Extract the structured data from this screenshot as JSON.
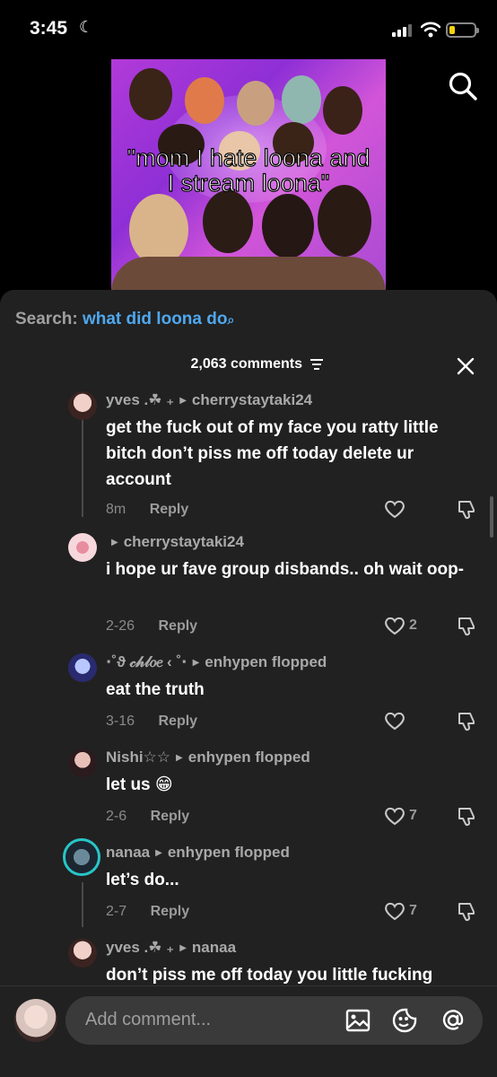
{
  "status": {
    "time": "3:45"
  },
  "video": {
    "caption_line1": "\"mom I hate loona and",
    "caption_line2": "I stream loona\""
  },
  "search": {
    "label": "Search:",
    "query": "what did loona do"
  },
  "header": {
    "count": "2,063 comments"
  },
  "comments": [
    {
      "user": "yves .☘︎ ₊",
      "reply_to": "cherrystaytaki24",
      "text": "get the fuck out of my face you ratty little bitch don’t piss me off today delete ur account",
      "time": "8m",
      "reply": "Reply",
      "likes": ""
    },
    {
      "user": "",
      "reply_to": "cherrystaytaki24",
      "text": "i hope ur fave group disbands.. oh wait oop-",
      "time": "2-26",
      "reply": "Reply",
      "likes": "2"
    },
    {
      "user": "⋅˚ϑ 𝒸𝒽𝓁𝑜𝑒 ‹ ˚⋅",
      "reply_to": "enhypen flopped",
      "text": "eat the truth",
      "time": "3-16",
      "reply": "Reply",
      "likes": ""
    },
    {
      "user": "Nishi☆☆",
      "reply_to": "enhypen flopped",
      "text": "let us 😁",
      "time": "2-6",
      "reply": "Reply",
      "likes": "7"
    },
    {
      "user": "nanaa",
      "reply_to": "enhypen flopped",
      "text": "let’s do...",
      "time": "2-7",
      "reply": "Reply",
      "likes": "7"
    },
    {
      "user": "yves .☘︎ ₊",
      "reply_to": "nanaa",
      "text": "don’t piss me off today you little fucking",
      "time": "",
      "reply": "",
      "likes": ""
    }
  ],
  "composer": {
    "placeholder": "Add comment..."
  }
}
